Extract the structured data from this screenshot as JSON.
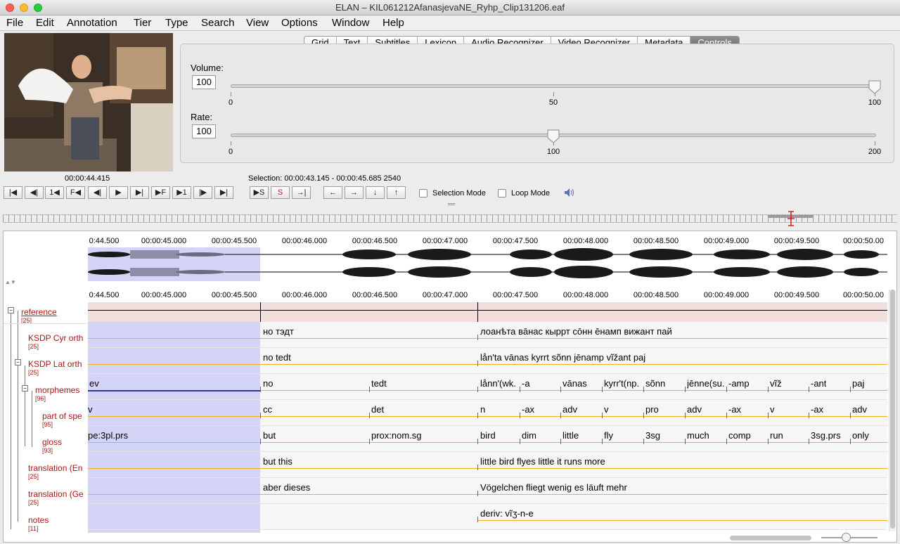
{
  "window": {
    "title": "ELAN – KIL061212AfanasjevaNE_Ryhp_Clip131206.eaf"
  },
  "menu": [
    "File",
    "Edit",
    "Annotation",
    "Tier",
    "Type",
    "Search",
    "View",
    "Options",
    "Window",
    "Help"
  ],
  "tabs": [
    "Grid",
    "Text",
    "Subtitles",
    "Lexicon",
    "Audio Recognizer",
    "Video Recognizer",
    "Metadata",
    "Controls"
  ],
  "active_tab": "Controls",
  "controls": {
    "volume": {
      "label": "Volume:",
      "value": "100",
      "ticks": [
        "0",
        "50",
        "100"
      ],
      "level": 100
    },
    "rate": {
      "label": "Rate:",
      "value": "100",
      "ticks": [
        "0",
        "100",
        "200"
      ],
      "level": 100
    }
  },
  "media": {
    "current_time": "00:00:44.415",
    "selection": "Selection: 00:00:43.145 - 00:00:45.685  2540"
  },
  "player_buttons": [
    {
      "name": "go-to-begin-button",
      "label": "|◀"
    },
    {
      "name": "previous-scrollview-button",
      "label": "◀|"
    },
    {
      "name": "previous-frame-button",
      "label": "1◀"
    },
    {
      "name": "previous-step-button",
      "label": "F◀"
    },
    {
      "name": "previous-pixel-button",
      "label": "◀|"
    },
    {
      "name": "play-button",
      "label": "▶"
    },
    {
      "name": "play-selection-button",
      "label": "▶|"
    },
    {
      "name": "next-step-button",
      "label": "▶F"
    },
    {
      "name": "next-frame-button",
      "label": "▶1"
    },
    {
      "name": "next-scrollview-button",
      "label": "|▶"
    },
    {
      "name": "go-to-end-button",
      "label": "▶|"
    }
  ],
  "selection_buttons": [
    {
      "name": "play-selection-s-button",
      "label": "▶S"
    },
    {
      "name": "clear-selection-button",
      "label": "S"
    },
    {
      "name": "selection-boundary-button",
      "label": "→|"
    }
  ],
  "nav_buttons": [
    {
      "name": "arrow-left-button",
      "label": "←"
    },
    {
      "name": "arrow-right-button",
      "label": "→"
    },
    {
      "name": "arrow-down-button",
      "label": "↓"
    },
    {
      "name": "arrow-up-button",
      "label": "↑"
    }
  ],
  "modes": {
    "selection_mode": "Selection Mode",
    "loop_mode": "Loop Mode"
  },
  "timeline": {
    "labels": [
      "0:44.500",
      "00:00:45.000",
      "00:00:45.500",
      "00:00:46.000",
      "00:00:46.500",
      "00:00:47.000",
      "00:00:47.500",
      "00:00:48.000",
      "00:00:48.500",
      "00:00:49.000",
      "00:00:49.500",
      "00:00:50.00"
    ]
  },
  "tiers": [
    {
      "name": "reference",
      "count": "[25]",
      "annotations": []
    },
    {
      "name": "KSDP Cyr orth",
      "count": "[25]",
      "annotations": [
        "но тэдт",
        "лоанѣта вāнас кыррт сōнн ēнамп вижант пай"
      ]
    },
    {
      "name": "KSDP Lat orth",
      "count": "[25]",
      "annotations": [
        "no tedt",
        "lån'ta vānas kyrrt sõnn jēnamp vĩžant paj"
      ]
    },
    {
      "name": "morphemes",
      "count": "[96]",
      "annotations": [
        "ev",
        "no",
        "tedt",
        "lånn'(wk.",
        "-a",
        "vānas",
        "kyrr't(np.",
        "sõnn",
        "jēnne(su.",
        "-amp",
        "vĩž",
        "-ant",
        "paj"
      ]
    },
    {
      "name": "part of spe",
      "count": "[95]",
      "annotations": [
        "v",
        "cc",
        "det",
        "n",
        "-ax",
        "adv",
        "v",
        "pro",
        "adv",
        "-ax",
        "v",
        "-ax",
        "adv"
      ]
    },
    {
      "name": "gloss",
      "count": "[93]",
      "annotations": [
        "pe:3pl.prs",
        "but",
        "prox:nom.sg",
        "bird",
        "dim",
        "little",
        "fly",
        "3sg",
        "much",
        "comp",
        "run",
        "3sg.prs",
        "only"
      ]
    },
    {
      "name": "translation (En",
      "count": "[25]",
      "annotations": [
        "but this",
        "little bird flyes little it runs more"
      ]
    },
    {
      "name": "translation (Ge",
      "count": "[25]",
      "annotations": [
        "aber dieses",
        "Vögelchen fliegt wenig es läuft mehr"
      ]
    },
    {
      "name": "notes",
      "count": "[11]",
      "annotations": [
        "deriv: vĩʒ-n-e"
      ]
    }
  ],
  "colors": {
    "tier_name": "#b11515",
    "selection": "#d4d4f7",
    "baseline": "#f0b020",
    "active_tab": "#7a7a7a"
  }
}
